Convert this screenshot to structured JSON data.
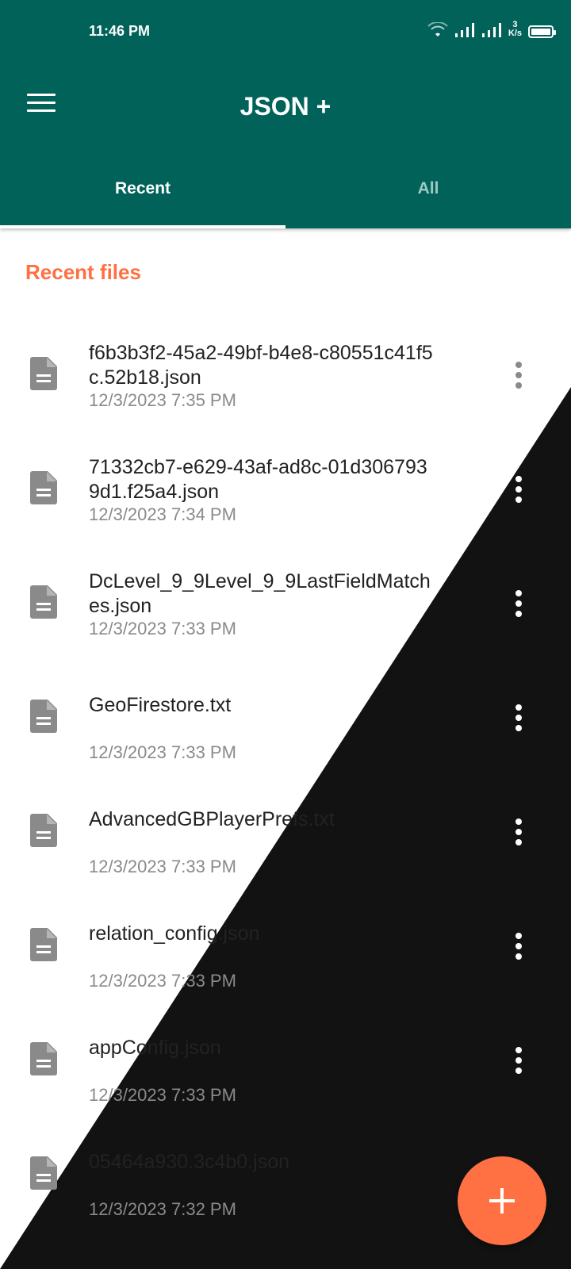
{
  "status_bar": {
    "time": "11:46 PM",
    "net_speed_value": "3",
    "net_speed_unit": "K/s",
    "icons": [
      "wifi-icon",
      "signal-icon",
      "signal-icon",
      "battery-icon"
    ]
  },
  "app_bar": {
    "title": "JSON +",
    "menu_icon": "menu-icon"
  },
  "tabs": [
    {
      "label": "Recent",
      "selected": true
    },
    {
      "label": "All",
      "selected": false
    }
  ],
  "section": {
    "title": "Recent files"
  },
  "files": [
    {
      "name": "f6b3b3f2-45a2-49bf-b4e8-c80551c41f5c.52b18.json",
      "date": "12/3/2023 7:35 PM"
    },
    {
      "name": "71332cb7-e629-43af-ad8c-01d3067939d1.f25a4.json",
      "date": "12/3/2023 7:34 PM"
    },
    {
      "name": "DcLevel_9_9Level_9_9LastFieldMatches.json",
      "date": "12/3/2023 7:33 PM"
    },
    {
      "name": "GeoFirestore.txt",
      "date": "12/3/2023 7:33 PM"
    },
    {
      "name": "AdvancedGBPlayerPrefs.txt",
      "date": "12/3/2023 7:33 PM"
    },
    {
      "name": "relation_config.json",
      "date": "12/3/2023 7:33 PM"
    },
    {
      "name": "appConfig.json",
      "date": "12/3/2023 7:33 PM"
    },
    {
      "name": "05464a930.3c4b0.json",
      "date": "12/3/2023 7:32 PM"
    }
  ],
  "colors": {
    "primary": "#01625a",
    "accent": "#ff7043",
    "overlay": "#121212"
  },
  "fab": {
    "icon": "plus-icon"
  }
}
